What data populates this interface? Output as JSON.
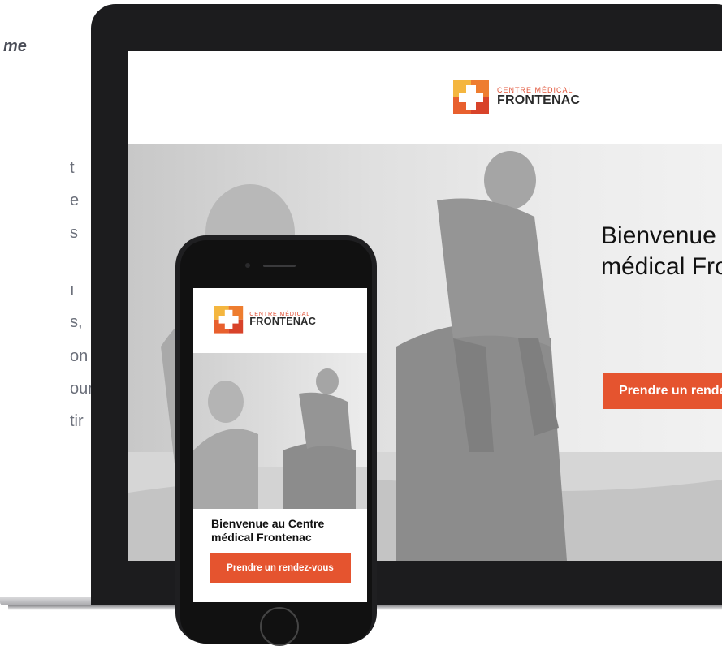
{
  "side_text": {
    "italic_fragment": "me",
    "fragments": [
      "t",
      "e",
      "s",
      "ı",
      "s,",
      "on",
      "our",
      "tir"
    ]
  },
  "brand": {
    "line1": "CENTRE MÉDICAL",
    "line2": "FRONTENAC",
    "colors": {
      "orange": "#f2a33a",
      "red": "#e5542f",
      "dark_red": "#d8432a"
    }
  },
  "desktop": {
    "headline": "Bienvenue au Centre médical Frontenac",
    "cta_label": "Prendre un rendez-vous"
  },
  "mobile": {
    "headline": "Bienvenue au Centre médical Frontenac",
    "cta_label": "Prendre un rendez-vous"
  },
  "accent": "#e5542f"
}
